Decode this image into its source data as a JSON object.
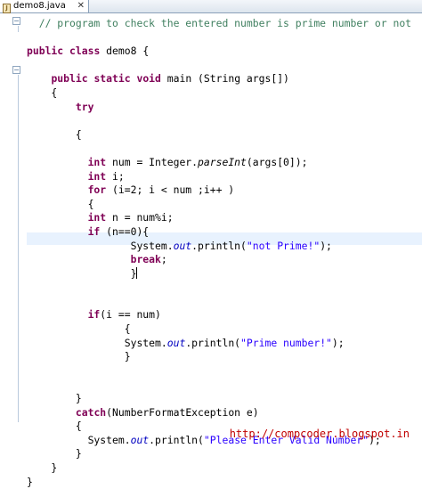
{
  "editor": {
    "tab": {
      "title": "demo8.java",
      "icon": "java-file-icon",
      "close_glyph": "✕"
    },
    "code_lines": [
      [
        {
          "t": "  // program to check the entered number is prime number or not",
          "c": "cm"
        }
      ],
      [
        {
          "t": ""
        }
      ],
      [
        {
          "t": "public",
          "c": "kw"
        },
        {
          "t": " "
        },
        {
          "t": "class",
          "c": "kw"
        },
        {
          "t": " demo8 {"
        }
      ],
      [
        {
          "t": ""
        }
      ],
      [
        {
          "t": "    "
        },
        {
          "t": "public",
          "c": "kw"
        },
        {
          "t": " "
        },
        {
          "t": "static",
          "c": "kw"
        },
        {
          "t": " "
        },
        {
          "t": "void",
          "c": "kw"
        },
        {
          "t": " main (String args[])"
        }
      ],
      [
        {
          "t": "    {"
        }
      ],
      [
        {
          "t": "        "
        },
        {
          "t": "try",
          "c": "kw"
        }
      ],
      [
        {
          "t": ""
        }
      ],
      [
        {
          "t": "        {"
        }
      ],
      [
        {
          "t": ""
        }
      ],
      [
        {
          "t": "          "
        },
        {
          "t": "int",
          "c": "kw"
        },
        {
          "t": " num = Integer."
        },
        {
          "t": "parseInt",
          "c": "it"
        },
        {
          "t": "(args[0]);"
        }
      ],
      [
        {
          "t": "          "
        },
        {
          "t": "int",
          "c": "kw"
        },
        {
          "t": " i;"
        }
      ],
      [
        {
          "t": "          "
        },
        {
          "t": "for",
          "c": "kw"
        },
        {
          "t": " (i=2; i < num ;i++ )"
        }
      ],
      [
        {
          "t": "          {"
        }
      ],
      [
        {
          "t": "          "
        },
        {
          "t": "int",
          "c": "kw"
        },
        {
          "t": " n = num%i;"
        }
      ],
      [
        {
          "t": "          "
        },
        {
          "t": "if",
          "c": "kw"
        },
        {
          "t": " (n==0){"
        }
      ],
      [
        {
          "t": "                 System."
        },
        {
          "t": "out",
          "c": "fd"
        },
        {
          "t": ".println("
        },
        {
          "t": "\"not Prime!\"",
          "c": "st"
        },
        {
          "t": ");"
        }
      ],
      [
        {
          "t": "                 "
        },
        {
          "t": "break",
          "c": "kw"
        },
        {
          "t": ";"
        }
      ],
      [
        {
          "t": "                 }"
        },
        {
          "caret": true
        }
      ],
      [
        {
          "t": ""
        }
      ],
      [
        {
          "t": ""
        }
      ],
      [
        {
          "t": "          "
        },
        {
          "t": "if",
          "c": "kw"
        },
        {
          "t": "(i == num)"
        }
      ],
      [
        {
          "t": "                {"
        }
      ],
      [
        {
          "t": "                System."
        },
        {
          "t": "out",
          "c": "fd"
        },
        {
          "t": ".println("
        },
        {
          "t": "\"Prime number!\"",
          "c": "st"
        },
        {
          "t": ");"
        }
      ],
      [
        {
          "t": "                }"
        }
      ],
      [
        {
          "t": ""
        }
      ],
      [
        {
          "t": ""
        }
      ],
      [
        {
          "t": "        }"
        }
      ],
      [
        {
          "t": "        "
        },
        {
          "t": "catch",
          "c": "kw"
        },
        {
          "t": "(NumberFormatException e)"
        }
      ],
      [
        {
          "t": "        {"
        }
      ],
      [
        {
          "t": "          System."
        },
        {
          "t": "out",
          "c": "fd"
        },
        {
          "t": ".println("
        },
        {
          "t": "\"Please Enter Valid Number\"",
          "c": "st"
        },
        {
          "t": ");"
        }
      ],
      [
        {
          "t": "        }"
        }
      ],
      [
        {
          "t": "    }"
        }
      ],
      [
        {
          "t": "}"
        }
      ]
    ]
  },
  "watermark": "http://compcoder.blogspot.in",
  "colors": {
    "keyword": "#7f0055",
    "comment": "#3f7f5f",
    "string": "#2a00ff",
    "field": "#0000c0",
    "highlight": "#e8f2fe",
    "watermark": "#c00000"
  }
}
